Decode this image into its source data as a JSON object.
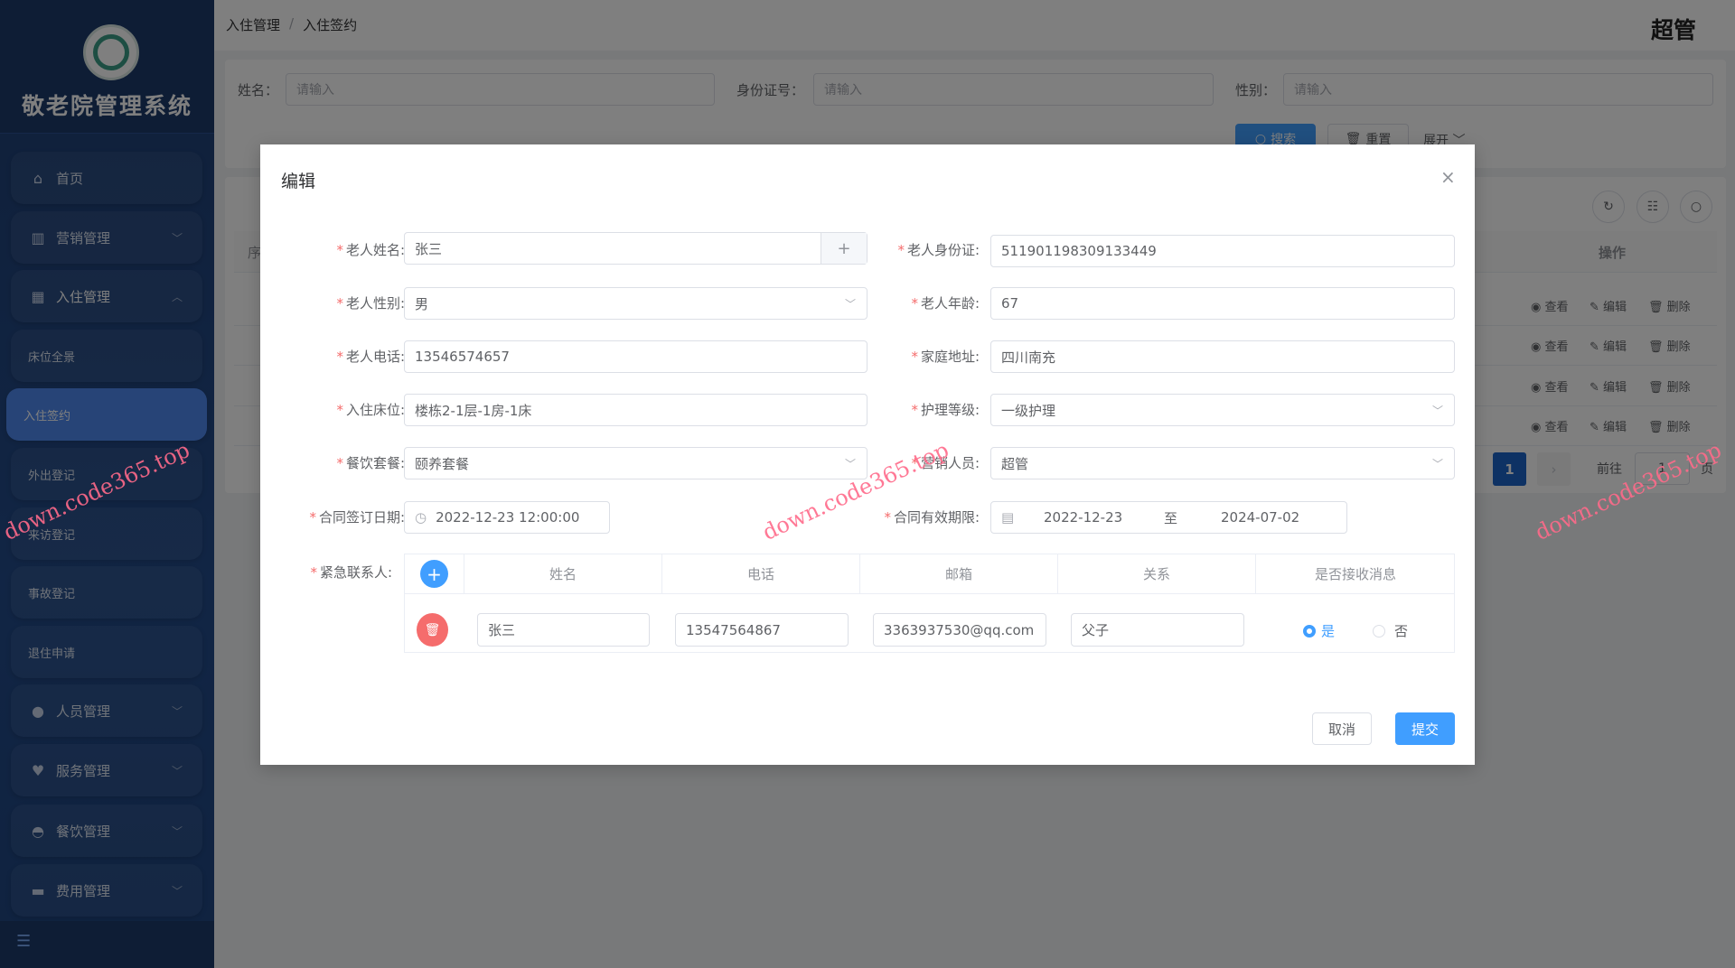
{
  "sidebar": {
    "title": "敬老院管理系统",
    "items": [
      {
        "label": "首页",
        "icon": "home-icon"
      },
      {
        "label": "营销管理",
        "icon": "chart-icon"
      },
      {
        "label": "入住管理",
        "icon": "building-icon"
      },
      {
        "label": "床位全景"
      },
      {
        "label": "入住签约"
      },
      {
        "label": "外出登记"
      },
      {
        "label": "来访登记"
      },
      {
        "label": "事故登记"
      },
      {
        "label": "退住申请"
      },
      {
        "label": "人员管理",
        "icon": "user-icon"
      },
      {
        "label": "服务管理",
        "icon": "heart-handshake-icon"
      },
      {
        "label": "餐饮管理",
        "icon": "bowl-icon"
      },
      {
        "label": "费用管理",
        "icon": "card-icon"
      }
    ]
  },
  "header": {
    "breadcrumb": [
      "入住管理",
      "入住签约"
    ],
    "separator": "/",
    "user": "超管"
  },
  "search": {
    "fields": [
      {
        "label": "姓名：",
        "placeholder": "请输入"
      },
      {
        "label": "身份证号：",
        "placeholder": "请输入"
      },
      {
        "label": "性别：",
        "placeholder": "请输入"
      }
    ],
    "search_label": "搜索",
    "reset_label": "重置",
    "expand_label": "展开"
  },
  "table": {
    "action_header": "操作",
    "partial_header": "序",
    "actions": {
      "view": "查看",
      "edit": "编辑",
      "delete": "删除"
    },
    "pagination": {
      "page": "1",
      "goto_label": "前往",
      "goto_value": "1",
      "page_suffix": "页"
    }
  },
  "modal": {
    "title": "编辑",
    "fields": {
      "name": {
        "label": "老人姓名:",
        "value": "张三"
      },
      "id_card": {
        "label": "老人身份证:",
        "value": "511901198309133449"
      },
      "gender": {
        "label": "老人性别:",
        "value": "男"
      },
      "age": {
        "label": "老人年龄:",
        "value": "67"
      },
      "phone": {
        "label": "老人电话:",
        "value": "13546574657"
      },
      "address": {
        "label": "家庭地址:",
        "value": "四川南充"
      },
      "bed": {
        "label": "入住床位:",
        "value": "楼栋2-1层-1房-1床"
      },
      "care_level": {
        "label": "护理等级:",
        "value": "一级护理"
      },
      "meal": {
        "label": "餐饮套餐:",
        "value": "颐养套餐"
      },
      "sales": {
        "label": "营销人员:",
        "value": "超管"
      },
      "sign_date": {
        "label": "合同签订日期:",
        "value": "2022-12-23 12:00:00"
      },
      "valid_range": {
        "label": "合同有效期限:",
        "start": "2022-12-23",
        "sep": "至",
        "end": "2024-07-02"
      }
    },
    "contacts": {
      "label": "紧急联系人:",
      "headers": [
        "姓名",
        "电话",
        "邮箱",
        "关系",
        "是否接收消息"
      ],
      "rows": [
        {
          "name": "张三",
          "phone": "13547564867",
          "email": "3363937530@qq.com",
          "relation": "父子",
          "yes": "是",
          "no": "否",
          "receive": "是"
        }
      ]
    },
    "cancel_label": "取消",
    "submit_label": "提交"
  },
  "watermark": "down.code365.top",
  "colors": {
    "primary": "#409eff",
    "sidebar": "#234b8a",
    "active_menu": "#4f89ee",
    "danger": "#f56c6c"
  }
}
